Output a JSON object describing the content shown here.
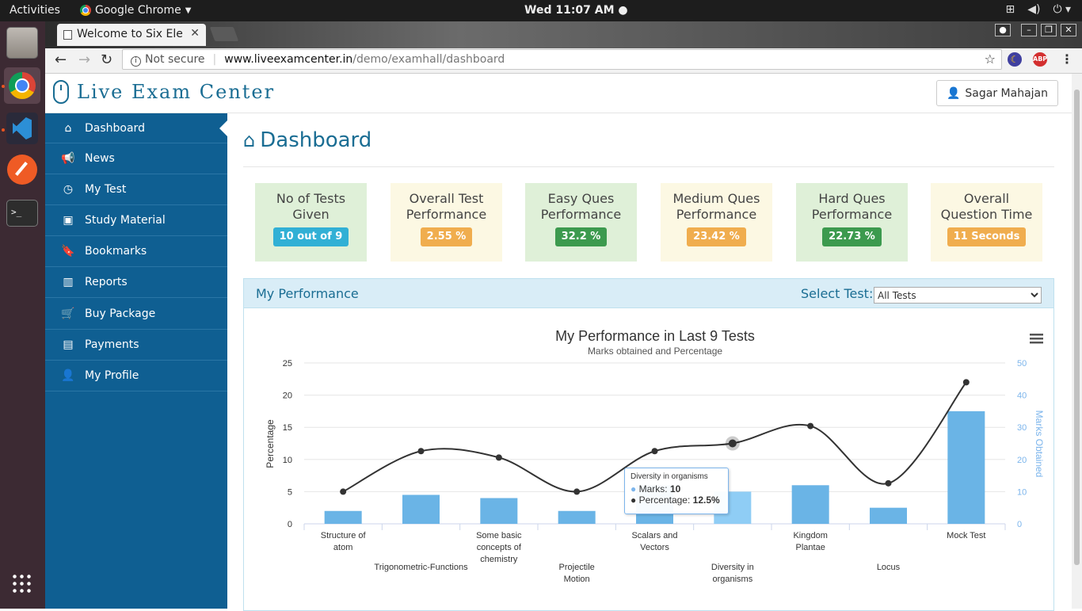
{
  "os": {
    "activities": "Activities",
    "app_name": "Google Chrome",
    "clock": "Wed 11:07 AM"
  },
  "browser": {
    "tab_title": "Welcome to Six Ele",
    "not_secure": "Not secure",
    "url_host": "www.liveexamcenter.in",
    "url_path": "/demo/examhall/dashboard"
  },
  "site": {
    "logo_text": "Live Exam Center",
    "user_name": "Sagar Mahajan"
  },
  "sidebar": {
    "items": [
      {
        "label": "Dashboard",
        "icon": "home-icon"
      },
      {
        "label": "News",
        "icon": "bullhorn-icon"
      },
      {
        "label": "My Test",
        "icon": "clock-icon"
      },
      {
        "label": "Study Material",
        "icon": "briefcase-icon"
      },
      {
        "label": "Bookmarks",
        "icon": "bookmark-icon"
      },
      {
        "label": "Reports",
        "icon": "bar-chart-icon"
      },
      {
        "label": "Buy Package",
        "icon": "cart-icon"
      },
      {
        "label": "Payments",
        "icon": "money-icon"
      },
      {
        "label": "My Profile",
        "icon": "user-icon"
      }
    ]
  },
  "page": {
    "title": "Dashboard"
  },
  "stats": [
    {
      "label": "No of Tests Given",
      "value": "10 out of 9",
      "badge_color": "#31b0d5",
      "bg": "#dff0d8"
    },
    {
      "label": "Overall Test Performance",
      "value": "2.55 %",
      "badge_color": "#f0ad4e",
      "bg": "#fcf8e3"
    },
    {
      "label": "Easy Ques Performance",
      "value": "32.2 %",
      "badge_color": "#3c9a4e",
      "bg": "#dff0d8"
    },
    {
      "label": "Medium Ques Performance",
      "value": "23.42 %",
      "badge_color": "#f0ad4e",
      "bg": "#fcf8e3"
    },
    {
      "label": "Hard Ques Performance",
      "value": "22.73 %",
      "badge_color": "#3c9a4e",
      "bg": "#dff0d8"
    },
    {
      "label": "Overall Question Time",
      "value": "11 Seconds",
      "badge_color": "#f0ad4e",
      "bg": "#fcf8e3"
    }
  ],
  "panel": {
    "title": "My Performance",
    "select_label": "Select Test:",
    "select_value": "All Tests"
  },
  "chart_data": {
    "type": "bar+line",
    "title": "My Performance in Last 9 Tests",
    "subtitle": "Marks obtained and Percentage",
    "ylabel_left": "Percentage",
    "ylabel_right": "Marks Obtained",
    "ylim_left": [
      0,
      25
    ],
    "ylim_right": [
      0,
      50
    ],
    "yticks_left": [
      "0",
      "5",
      "10",
      "15",
      "20",
      "25"
    ],
    "yticks_right": [
      "0",
      "10",
      "20",
      "30",
      "40",
      "50"
    ],
    "categories": [
      "Structure of atom",
      "Trigonometric-Functions",
      "Some basic concepts of chemistry",
      "Projectile Motion",
      "Scalars and Vectors",
      "Diversity in organisms",
      "Kingdom Plantae",
      "Locus",
      "Mock Test"
    ],
    "category_lines": [
      [
        "Structure of",
        "atom"
      ],
      [
        "Trigonometric-Functions"
      ],
      [
        "Some basic",
        "concepts of",
        "chemistry"
      ],
      [
        "Projectile",
        "Motion"
      ],
      [
        "Scalars and",
        "Vectors"
      ],
      [
        "Diversity in",
        "organisms"
      ],
      [
        "Kingdom",
        "Plantae"
      ],
      [
        "Locus"
      ],
      [
        "Mock Test"
      ]
    ],
    "series": [
      {
        "name": "Marks",
        "axis": "right",
        "type": "bar",
        "color": "#6ab4e6",
        "values": [
          4,
          9,
          8,
          4,
          12,
          10,
          12,
          5,
          35
        ]
      },
      {
        "name": "Percentage",
        "axis": "left",
        "type": "line",
        "color": "#333333",
        "values": [
          5,
          11.3,
          10.3,
          5,
          11.3,
          12.5,
          15.2,
          6.3,
          22
        ]
      }
    ],
    "tooltip": {
      "title": "Diversity in organisms",
      "marks_label": "Marks:",
      "marks_value": "10",
      "pct_label": "Percentage:",
      "pct_value": "12.5%"
    },
    "menu_icon": "hamburger-icon"
  }
}
